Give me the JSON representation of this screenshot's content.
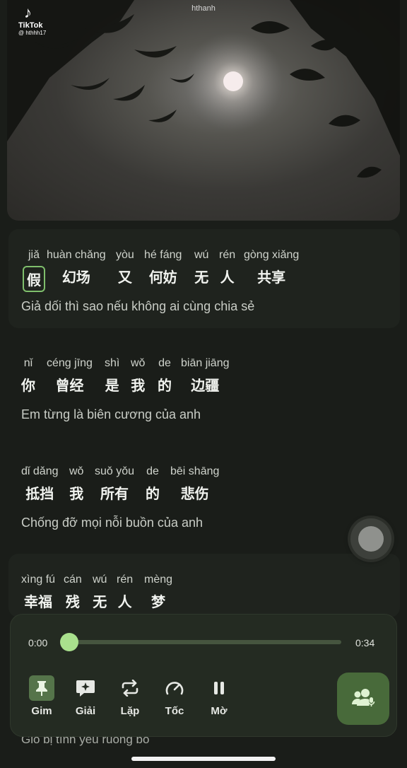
{
  "video": {
    "brand": "TikTok",
    "handle": "@ hthhh17",
    "watermark": "hthanh"
  },
  "lyrics": [
    {
      "words": [
        {
          "pinyin": "jiǎ",
          "hanzi": "假",
          "highlighted": true
        },
        {
          "pinyin": "huàn chǎng",
          "hanzi": "幻场"
        },
        {
          "pinyin": "yòu",
          "hanzi": "又"
        },
        {
          "pinyin": "hé fáng",
          "hanzi": "何妨"
        },
        {
          "pinyin": "wú",
          "hanzi": "无"
        },
        {
          "pinyin": "rén",
          "hanzi": "人"
        },
        {
          "pinyin": "gòng xiǎng",
          "hanzi": "共享"
        }
      ],
      "translation": "Giả dối thì sao nếu không ai cùng chia sẻ"
    },
    {
      "words": [
        {
          "pinyin": "nǐ",
          "hanzi": "你"
        },
        {
          "pinyin": "céng jīng",
          "hanzi": "曾经"
        },
        {
          "pinyin": "shì",
          "hanzi": "是"
        },
        {
          "pinyin": "wǒ",
          "hanzi": "我"
        },
        {
          "pinyin": "de",
          "hanzi": "的"
        },
        {
          "pinyin": "biān jiāng",
          "hanzi": "边疆"
        }
      ],
      "translation": "Em từng là biên cương của anh"
    },
    {
      "words": [
        {
          "pinyin": "dǐ dǎng",
          "hanzi": "抵挡"
        },
        {
          "pinyin": "wǒ",
          "hanzi": "我"
        },
        {
          "pinyin": "suǒ yǒu",
          "hanzi": "所有"
        },
        {
          "pinyin": "de",
          "hanzi": "的"
        },
        {
          "pinyin": "bēi shāng",
          "hanzi": "悲伤"
        }
      ],
      "translation": "Chống đỡ mọi nỗi buồn của anh"
    },
    {
      "words": [
        {
          "pinyin": "xìng fú",
          "hanzi": "幸福"
        },
        {
          "pinyin": "cán",
          "hanzi": "残"
        },
        {
          "pinyin": "wú",
          "hanzi": "无"
        },
        {
          "pinyin": "rén",
          "hanzi": "人"
        },
        {
          "pinyin": "mèng",
          "hanzi": "梦"
        }
      ],
      "translation": ""
    }
  ],
  "partial_translation": "Gió bị tình yêu ruồng bỏ",
  "player": {
    "current_time": "0:00",
    "duration": "0:34",
    "progress": 0,
    "controls": [
      {
        "id": "pin",
        "label": "Gim",
        "icon": "pin-icon",
        "active": true
      },
      {
        "id": "explain",
        "label": "Giải",
        "icon": "sparkle-chat-icon",
        "active": false
      },
      {
        "id": "repeat",
        "label": "Lặp",
        "icon": "repeat-icon",
        "active": false
      },
      {
        "id": "speed",
        "label": "Tốc",
        "icon": "speedometer-icon",
        "active": false
      },
      {
        "id": "pause",
        "label": "Mờ",
        "icon": "pause-icon",
        "active": false
      }
    ],
    "voice_button_icon": "users-mic-icon"
  },
  "colors": {
    "background": "#1a1d19",
    "accent": "#a9e08d",
    "accent_dark": "#486a3a"
  }
}
